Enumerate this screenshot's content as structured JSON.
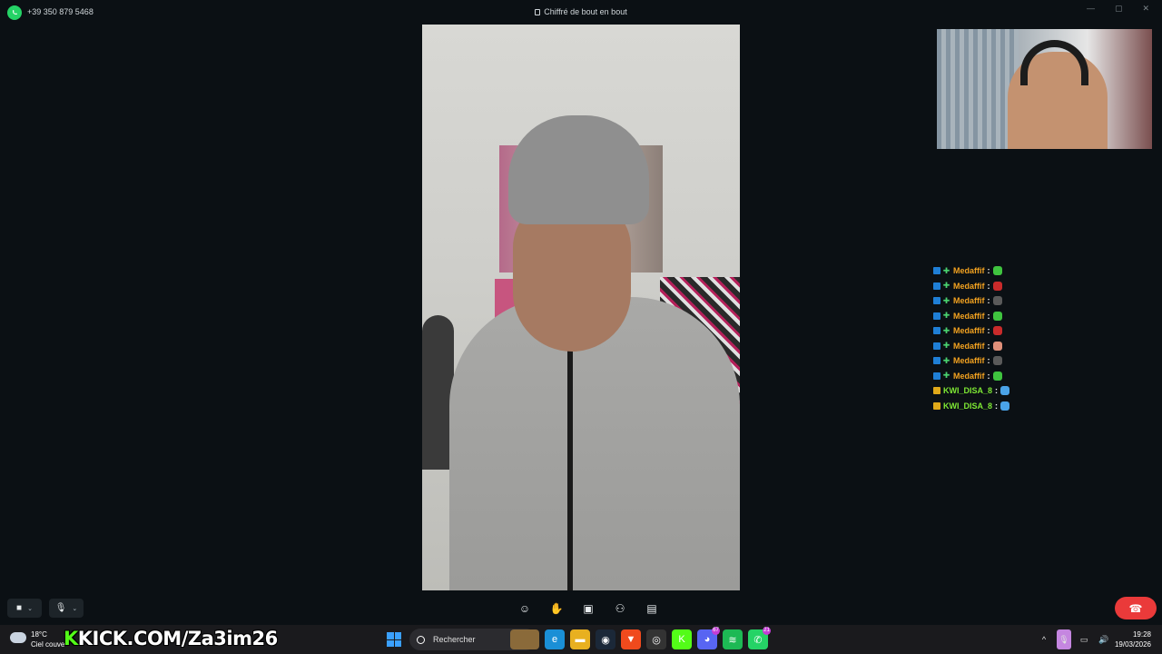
{
  "titlebar": {
    "phone_number": "+39 350 879 5468",
    "encryption_text": "Chiffré de bout en bout"
  },
  "chat": [
    {
      "user": "Medaffif",
      "badges": [
        "verified",
        "sub"
      ],
      "color": "#f3a220",
      "emote_color": "#3fc43f"
    },
    {
      "user": "Medaffif",
      "badges": [
        "verified",
        "sub"
      ],
      "color": "#f3a220",
      "emote_color": "#c92b2b"
    },
    {
      "user": "Medaffif",
      "badges": [
        "verified",
        "sub"
      ],
      "color": "#f3a220",
      "emote_color": "#5a5a5a"
    },
    {
      "user": "Medaffif",
      "badges": [
        "verified",
        "sub"
      ],
      "color": "#f3a220",
      "emote_color": "#3fc43f"
    },
    {
      "user": "Medaffif",
      "badges": [
        "verified",
        "sub"
      ],
      "color": "#f3a220",
      "emote_color": "#c92b2b"
    },
    {
      "user": "Medaffif",
      "badges": [
        "verified",
        "sub"
      ],
      "color": "#f3a220",
      "emote_color": "#e0907a"
    },
    {
      "user": "Medaffif",
      "badges": [
        "verified",
        "sub"
      ],
      "color": "#f3a220",
      "emote_color": "#5a5a5a"
    },
    {
      "user": "Medaffif",
      "badges": [
        "verified",
        "sub"
      ],
      "color": "#f3a220",
      "emote_color": "#3fc43f"
    },
    {
      "user": "KWI_DISA_8",
      "badges": [
        "gift"
      ],
      "color": "#7ee834",
      "emote_color": "#4aa3e8"
    },
    {
      "user": "KWI_DISA_8",
      "badges": [
        "gift"
      ],
      "color": "#7ee834",
      "emote_color": "#4aa3e8"
    }
  ],
  "chat_separator": ":",
  "weather": {
    "temp": "18°C",
    "desc": "Ciel couve"
  },
  "overlay": {
    "kick_k": "K",
    "kick_url": "KICK.COM/Za3im26"
  },
  "taskbar": {
    "search_label": "Rechercher",
    "apps": [
      {
        "name": "edge",
        "color": "#1a8fd6",
        "glyph": "e"
      },
      {
        "name": "files",
        "color": "#e8b020",
        "glyph": "▬"
      },
      {
        "name": "steam",
        "color": "#1b2838",
        "glyph": "◉"
      },
      {
        "name": "brave",
        "color": "#f04a1d",
        "glyph": "▼"
      },
      {
        "name": "obs",
        "color": "#333333",
        "glyph": "◎"
      },
      {
        "name": "kick",
        "color": "#53fc18",
        "glyph": "K"
      },
      {
        "name": "discord",
        "color": "#5865f2",
        "glyph": "◕",
        "badge": "67"
      },
      {
        "name": "spotify",
        "color": "#1db954",
        "glyph": "≋"
      },
      {
        "name": "whatsapp",
        "color": "#25d366",
        "glyph": "✆",
        "badge": "21"
      }
    ],
    "clock_time": "19:28",
    "clock_date": "19/03/2026"
  },
  "colors": {
    "end_call": "#ea3a3a",
    "brand_green": "#25d366"
  }
}
